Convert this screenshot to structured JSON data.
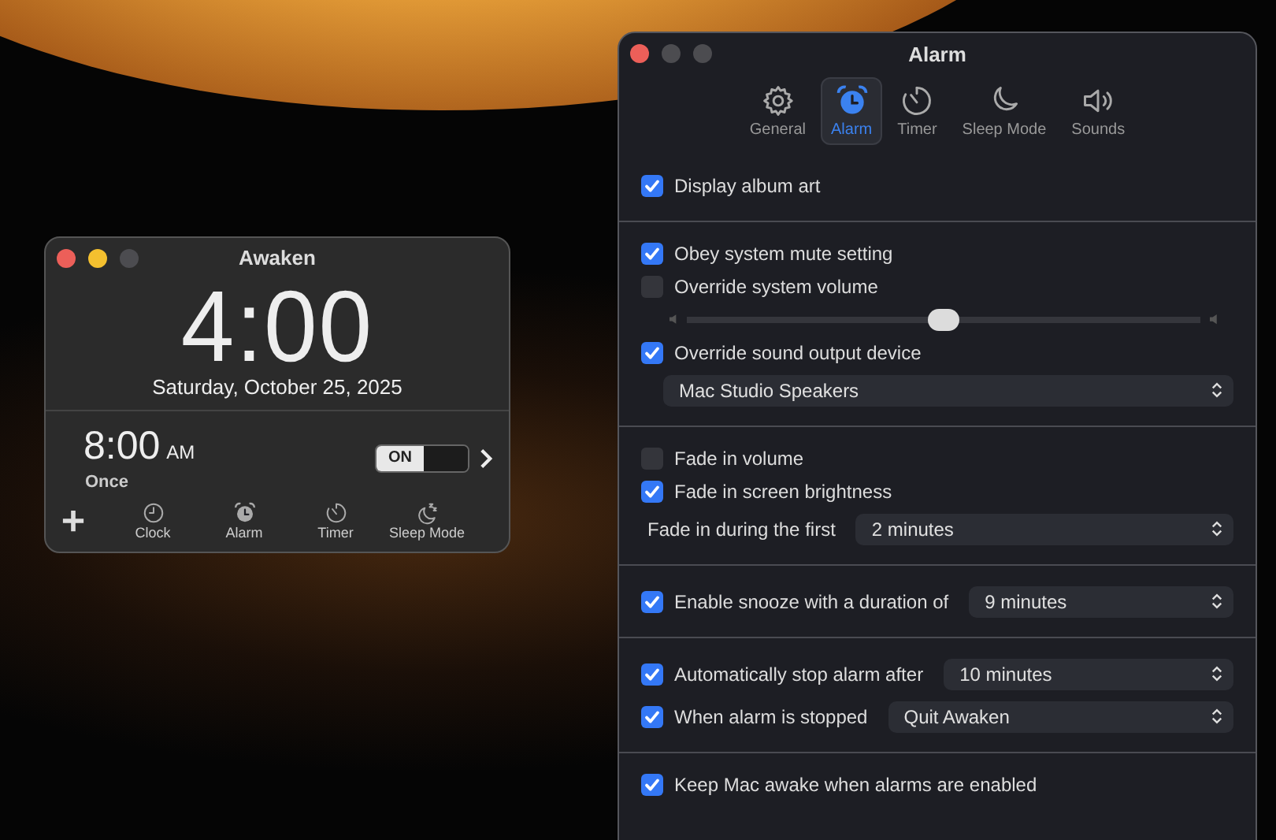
{
  "clock_window": {
    "title": "Awaken",
    "time": "4:00",
    "date": "Saturday, October 25, 2025",
    "alarm": {
      "time": "8:00",
      "period": "AM",
      "repeat": "Once",
      "on": true,
      "switch_label": "ON"
    },
    "toolbar": [
      {
        "label": "Clock"
      },
      {
        "label": "Alarm"
      },
      {
        "label": "Timer"
      },
      {
        "label": "Sleep Mode"
      }
    ]
  },
  "settings_window": {
    "title": "Alarm",
    "tabs": [
      {
        "label": "General",
        "selected": false
      },
      {
        "label": "Alarm",
        "selected": true
      },
      {
        "label": "Timer",
        "selected": false
      },
      {
        "label": "Sleep Mode",
        "selected": false
      },
      {
        "label": "Sounds",
        "selected": false
      }
    ],
    "sections": [
      [
        {
          "kind": "checkbox",
          "label": "Display album art",
          "checked": true
        }
      ],
      [
        {
          "kind": "checkbox",
          "label": "Obey system mute setting",
          "checked": true
        },
        {
          "kind": "checkbox",
          "label": "Override system volume",
          "checked": false
        },
        {
          "kind": "slider",
          "level": 0.5
        },
        {
          "kind": "checkbox",
          "label": "Override sound output device",
          "checked": true
        },
        {
          "kind": "select",
          "value": "Mac Studio Speakers"
        }
      ],
      [
        {
          "kind": "checkbox",
          "label": "Fade in volume",
          "checked": false
        },
        {
          "kind": "checkbox",
          "label": "Fade in screen brightness",
          "checked": true
        },
        {
          "kind": "label-select",
          "label": "Fade in during the first",
          "value": "2 minutes"
        }
      ],
      [
        {
          "kind": "checkbox-select",
          "label": "Enable snooze with a duration of",
          "checked": true,
          "value": "9 minutes"
        }
      ],
      [
        {
          "kind": "checkbox-select",
          "label": "Automatically stop alarm after",
          "checked": true,
          "value": "10 minutes"
        },
        {
          "kind": "checkbox-select",
          "label": "When alarm is stopped",
          "checked": true,
          "value": "Quit Awaken"
        }
      ],
      [
        {
          "kind": "checkbox",
          "label": "Keep Mac awake when alarms are enabled",
          "checked": true
        }
      ]
    ]
  }
}
